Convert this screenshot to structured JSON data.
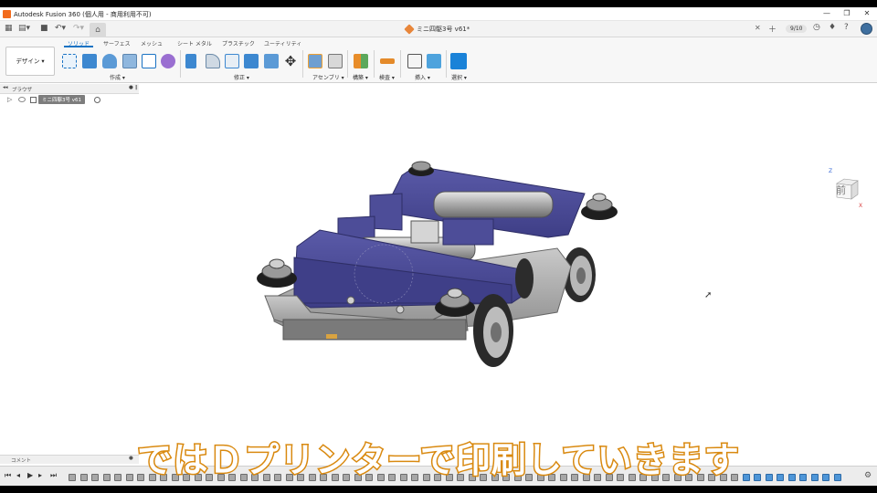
{
  "window": {
    "app_title": "Autodesk Fusion 360 (個人用 - 商用利用不可)",
    "minimize_icon": "minimize-icon",
    "maximize_icon": "restore-icon",
    "close_icon": "close-icon"
  },
  "tabbar": {
    "document_title": "ミニ四駆3号 v61*",
    "jobs_label": "9/10"
  },
  "ribbon": {
    "workspace_label": "デザイン ▾",
    "tabs": [
      "ソリッド",
      "サーフェス",
      "メッシュ",
      "シート メタル",
      "プラスチック",
      "ユーティリティ"
    ],
    "active_tab": "ソリッド",
    "groups": [
      "作成 ▾",
      "修正 ▾",
      "アセンブリ ▾",
      "構築 ▾",
      "検査 ▾",
      "挿入 ▾",
      "選択 ▾"
    ]
  },
  "browser": {
    "header_label": "ブラウザ",
    "root_item_label": "ミニ四駆3号 v61"
  },
  "viewcube": {
    "face_label": "前",
    "axis_x": "X",
    "axis_z": "Z"
  },
  "comments": {
    "label": "コメント"
  },
  "subtitle": {
    "text": "ではＤプリンターで印刷していきます"
  },
  "colors": {
    "accent": "#1a73c4",
    "body_purple": "#4a4a94",
    "subtitle_stroke": "#d9890f"
  }
}
